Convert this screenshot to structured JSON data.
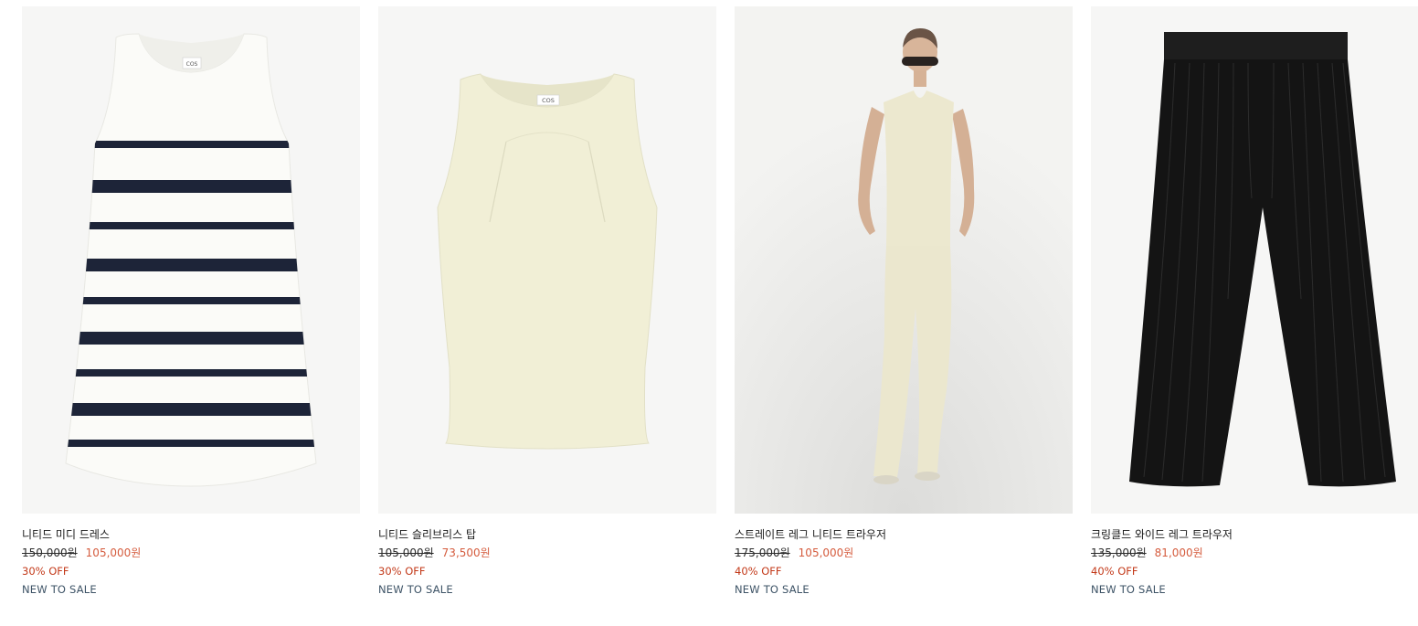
{
  "products": [
    {
      "name": "니티드 미디 드레스",
      "original_price": "150,000원",
      "sale_price": "105,000원",
      "discount": "30% OFF",
      "tag": "NEW TO SALE",
      "label_text": "COS"
    },
    {
      "name": "니티드 슬리브리스 탑",
      "original_price": "105,000원",
      "sale_price": "73,500원",
      "discount": "30% OFF",
      "tag": "NEW TO SALE",
      "label_text": "COS"
    },
    {
      "name": "스트레이트 레그 니티드 트라우저",
      "original_price": "175,000원",
      "sale_price": "105,000원",
      "discount": "40% OFF",
      "tag": "NEW TO SALE"
    },
    {
      "name": "크링클드 와이드 레그 트라우저",
      "original_price": "135,000원",
      "sale_price": "81,000원",
      "discount": "40% OFF",
      "tag": "NEW TO SALE"
    }
  ],
  "colors": {
    "sale_price": "#d55c3e",
    "discount": "#c33a1a",
    "tag": "#3d5366",
    "stripe": "#1d2438",
    "cream": "#f1efd6"
  }
}
